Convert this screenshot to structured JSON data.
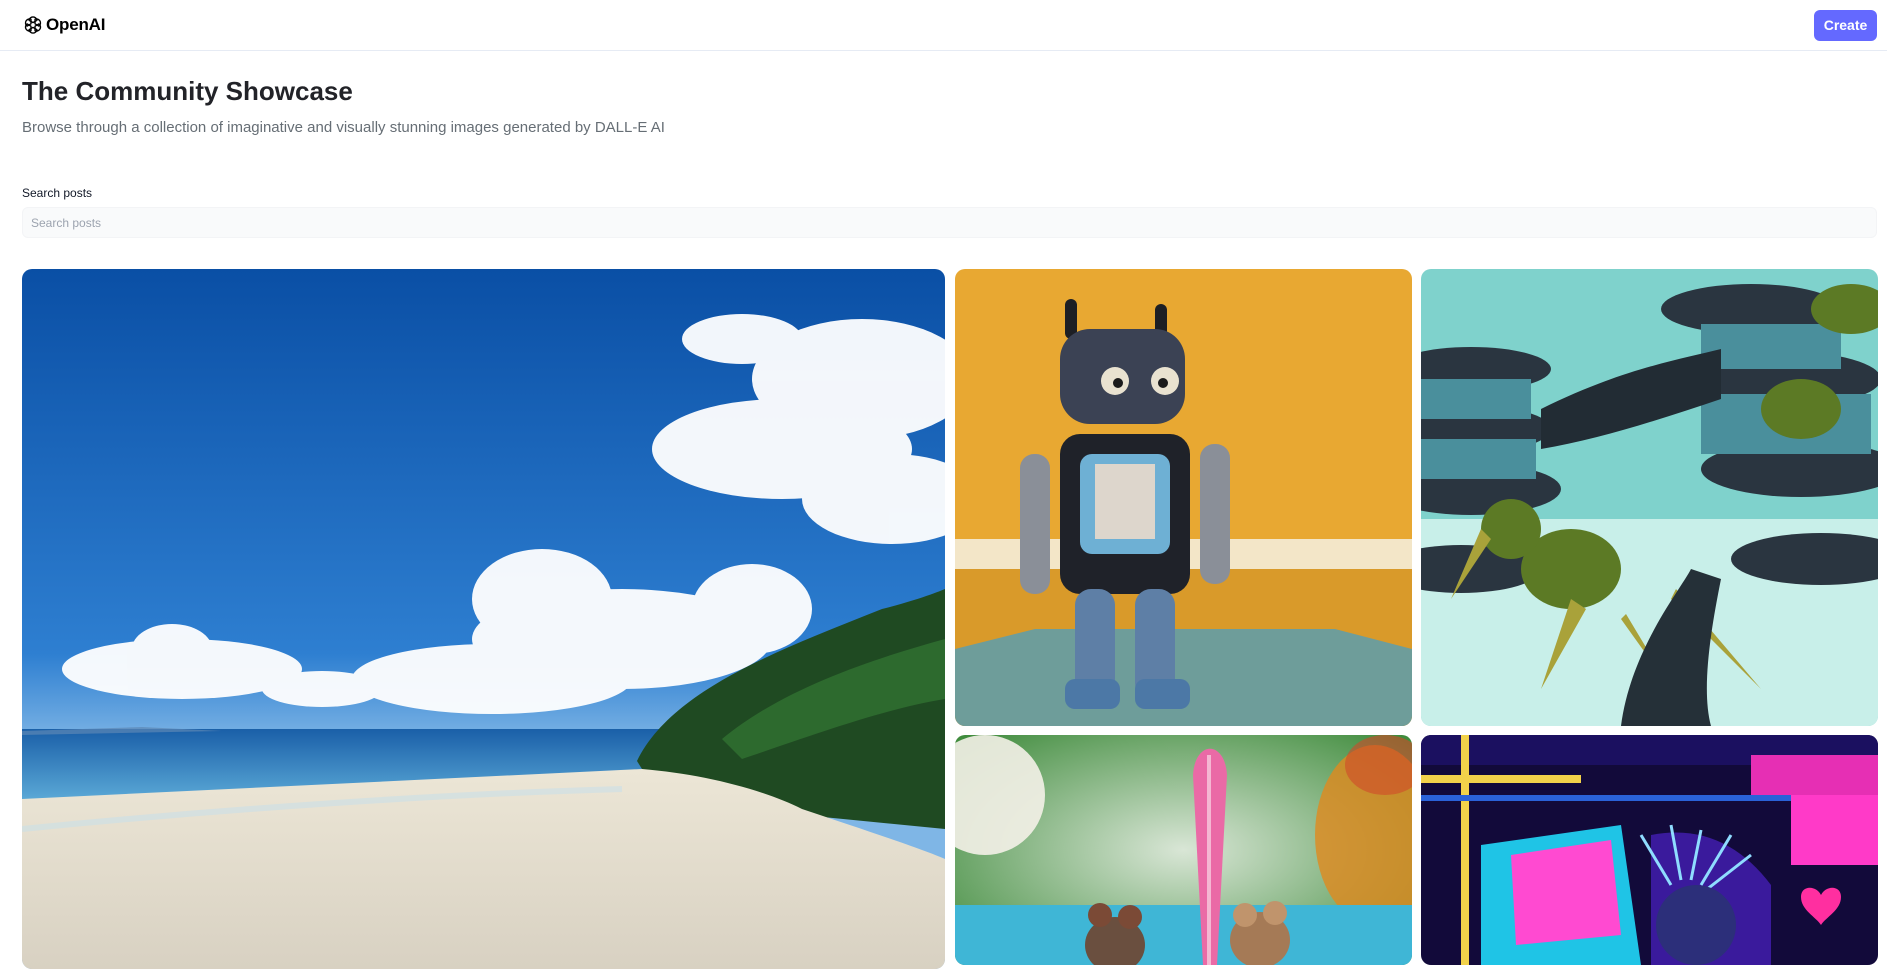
{
  "header": {
    "logo_text": "OpenAI",
    "create_label": "Create"
  },
  "main": {
    "title": "The Community Showcase",
    "subtitle": "Browse through a collection of imaginative and visually stunning images generated by DALL-E AI",
    "search": {
      "label": "Search posts",
      "placeholder": "Search posts",
      "value": ""
    }
  },
  "gallery": {
    "cards": [
      {
        "name": "beach-image"
      },
      {
        "name": "felt-robot-image"
      },
      {
        "name": "futuristic-greenery-city-image"
      },
      {
        "name": "koalas-surfboard-image"
      },
      {
        "name": "neon-synthwave-image"
      }
    ]
  },
  "colors": {
    "accent": "#6469ff",
    "title": "#222328",
    "subtitle": "#666e75",
    "input_bg": "#f9fafb"
  }
}
